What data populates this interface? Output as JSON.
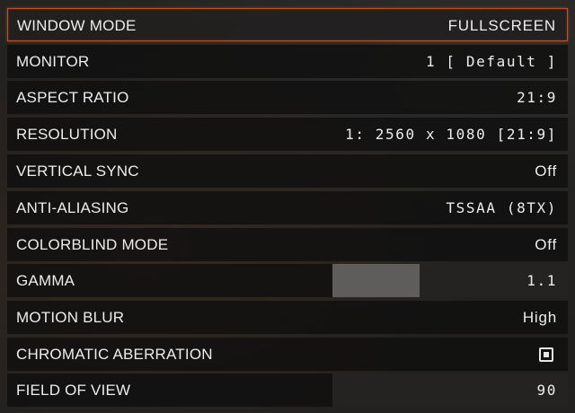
{
  "settings": [
    {
      "id": "window-mode",
      "label": "WINDOW MODE",
      "value": "FULLSCREEN",
      "type": "select",
      "selected": true
    },
    {
      "id": "monitor",
      "label": "MONITOR",
      "value": "1 [ Default ]",
      "type": "select"
    },
    {
      "id": "aspect-ratio",
      "label": "ASPECT RATIO",
      "value": "21:9",
      "type": "select"
    },
    {
      "id": "resolution",
      "label": "RESOLUTION",
      "value": "1: 2560 x 1080 [21:9]",
      "type": "select"
    },
    {
      "id": "vertical-sync",
      "label": "VERTICAL SYNC",
      "value": "Off",
      "type": "select"
    },
    {
      "id": "anti-aliasing",
      "label": "ANTI-ALIASING",
      "value": "TSSAA (8TX)",
      "type": "select"
    },
    {
      "id": "colorblind-mode",
      "label": "COLORBLIND MODE",
      "value": "Off",
      "type": "select"
    },
    {
      "id": "gamma",
      "label": "GAMMA",
      "value": "1.1",
      "type": "slider",
      "level": 0.37
    },
    {
      "id": "motion-blur",
      "label": "MOTION BLUR",
      "value": "High",
      "type": "select"
    },
    {
      "id": "chromatic-aberration",
      "label": "CHROMATIC ABERRATION",
      "value": "",
      "type": "checkbox",
      "checked": true
    },
    {
      "id": "field-of-view",
      "label": "FIELD OF VIEW",
      "value": "90",
      "type": "slider",
      "level": 0.0
    }
  ],
  "colors": {
    "accent": "#c0501f",
    "text": "#ececec"
  },
  "icons": {
    "checkbox": "checkbox-checked-icon"
  }
}
